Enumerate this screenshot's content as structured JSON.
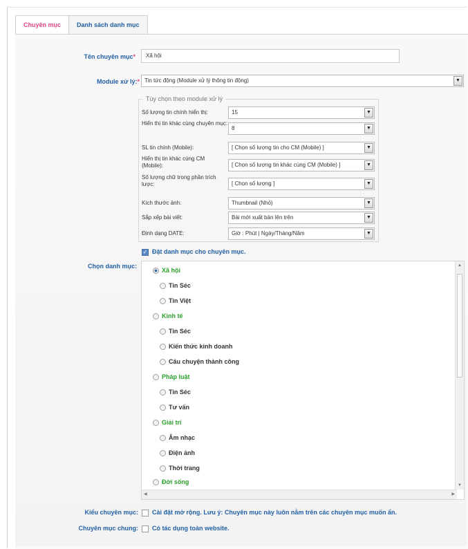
{
  "tabs": [
    {
      "label": "Chuyên mục",
      "active": true
    },
    {
      "label": "Danh sách danh mục",
      "active": false
    }
  ],
  "form": {
    "name_label": "Tên chuyên mục",
    "name_value": "Xã hội",
    "module_label": "Module xử lý:",
    "module_value": "Tin tức động (Module xử lý thông tin động)",
    "required_mark": "*"
  },
  "options": {
    "legend": "Tùy chọn theo module xử lý",
    "rows": [
      {
        "label": "Số lượng tin chính hiển thị:",
        "value": "15"
      },
      {
        "label": "Hiển thị tin khác cùng chuyên mục:",
        "value": "8"
      },
      {
        "label": "SL tin chính (Mobile):",
        "value": "[ Chọn số lượng tin cho CM (Mobile) ]"
      },
      {
        "label": "Hiển thị tin khác cùng CM (Mobile):",
        "value": "[ Chọn số lượng tin khác cùng CM (Mobile) ]"
      },
      {
        "label": "Số lượng chữ trong phần trích lược:",
        "value": "[ Chọn số lượng ]"
      },
      {
        "label": "Kích thước ảnh:",
        "value": "Thumbnail (Nhỏ)"
      },
      {
        "label": "Sắp xếp bài viết:",
        "value": "Bài mới xuất bản lên trên"
      },
      {
        "label": "Định dạng DATE:",
        "value": "Giờ : Phút | Ngày/Tháng/Năm"
      }
    ]
  },
  "set_category": {
    "label": "Đặt danh mục cho chuyên mục.",
    "checked": true
  },
  "category": {
    "label": "Chọn danh mục:",
    "tree": [
      {
        "label": "Xã hội",
        "level": 0,
        "selected": true
      },
      {
        "label": "Tin Séc",
        "level": 1
      },
      {
        "label": "Tin Việt",
        "level": 1
      },
      {
        "label": "Kinh tế",
        "level": 0
      },
      {
        "label": "Tin Séc",
        "level": 1
      },
      {
        "label": "Kiến thức kinh doanh",
        "level": 1
      },
      {
        "label": "Câu chuyện thành công",
        "level": 1
      },
      {
        "label": "Pháp luật",
        "level": 0
      },
      {
        "label": "Tin Séc",
        "level": 1
      },
      {
        "label": "Tư vấn",
        "level": 1
      },
      {
        "label": "Giải trí",
        "level": 0
      },
      {
        "label": "Âm nhạc",
        "level": 1
      },
      {
        "label": "Điện ảnh",
        "level": 1
      },
      {
        "label": "Thời trang",
        "level": 1
      },
      {
        "label": "Đời sống",
        "level": 0
      }
    ]
  },
  "kieu": {
    "label": "Kiểu chuyên mục:",
    "text": "Cài đặt mở rộng. Lưu ý: Chuyên mục này luôn nằm trên các chuyên mục muốn ẩn.",
    "checked": false
  },
  "chung": {
    "label": "Chuyên mục chung:",
    "text": "Có tác dụng toàn website.",
    "checked": false
  },
  "icons": {
    "dropdown": "chevron-down-icon",
    "check": "check-icon"
  }
}
